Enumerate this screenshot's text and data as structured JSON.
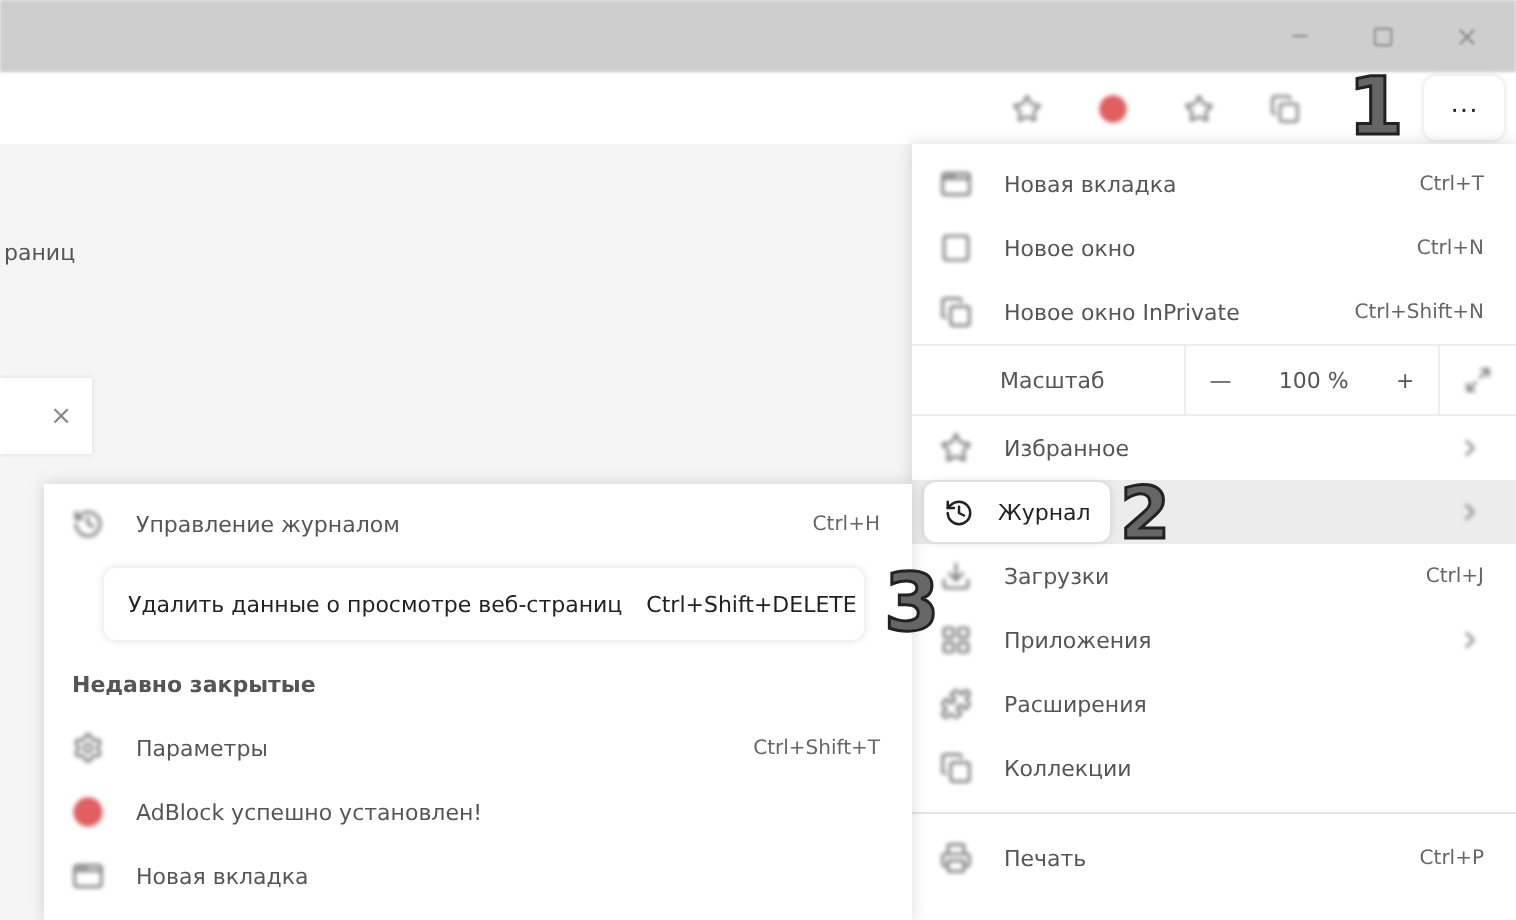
{
  "page": {
    "text": "раниц",
    "notice_close": "×"
  },
  "more_button": {
    "label": "···",
    "marker": "1"
  },
  "main_menu": {
    "items": [
      {
        "kind": "item",
        "label": "Новая вкладка",
        "shortcut": "Ctrl+T"
      },
      {
        "kind": "item",
        "label": "Новое окно",
        "shortcut": "Ctrl+N"
      },
      {
        "kind": "item",
        "label": "Новое окно InPrivate",
        "shortcut": "Ctrl+Shift+N"
      },
      {
        "kind": "zoom",
        "label": "Масштаб",
        "minus": "—",
        "value": "100 %",
        "plus": "+"
      },
      {
        "kind": "item",
        "label": "Избранное",
        "submenu": true
      },
      {
        "kind": "highlight",
        "label": "Журнал",
        "marker": "2",
        "submenu": true
      },
      {
        "kind": "item",
        "label": "Загрузки",
        "shortcut": "Ctrl+J"
      },
      {
        "kind": "item",
        "label": "Приложения",
        "submenu": true
      },
      {
        "kind": "item",
        "label": "Расширения"
      },
      {
        "kind": "item",
        "label": "Коллекции"
      },
      {
        "kind": "divider"
      },
      {
        "kind": "item",
        "label": "Печать",
        "shortcut": "Ctrl+P"
      }
    ]
  },
  "history_menu": {
    "manage": {
      "label": "Управление журналом",
      "shortcut": "Ctrl+H"
    },
    "clear": {
      "label": "Удалить данные о просмотре веб-страниц",
      "shortcut": "Ctrl+Shift+DELETE",
      "marker": "3"
    },
    "recent_heading": "Недавно закрытые",
    "recent": [
      {
        "label": "Параметры",
        "shortcut": "Ctrl+Shift+T"
      },
      {
        "label": "AdBlock успешно установлен!"
      },
      {
        "label": "Новая вкладка"
      }
    ]
  }
}
